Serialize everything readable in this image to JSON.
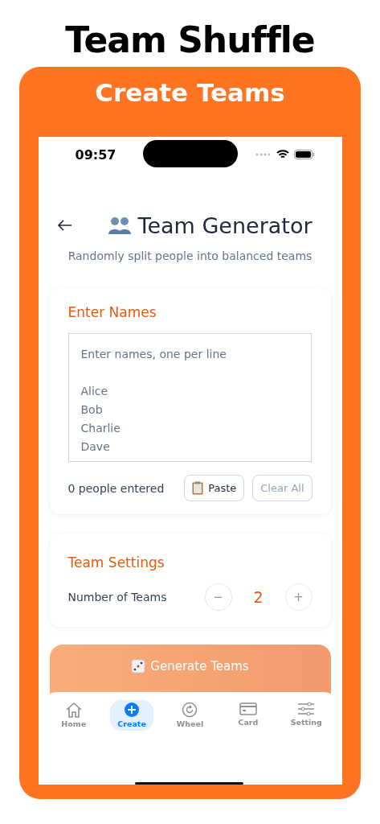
{
  "title": "Team Shuffle",
  "banner": "Create Teams",
  "status_bar": {
    "time": "09:57"
  },
  "header": {
    "title": "Team Generator",
    "subtitle": "Randomly split people into balanced teams"
  },
  "names_card": {
    "heading": "Enter Names",
    "placeholder": "Enter names, one per line\n\nAlice\nBob\nCharlie\nDave",
    "count": "0 people entered",
    "paste_button": "Paste",
    "clear_button": "Clear All"
  },
  "settings_card": {
    "heading": "Team Settings",
    "label": "Number of Teams",
    "decrement": "−",
    "value": "2",
    "increment": "+"
  },
  "generate_button": "Generate Teams",
  "tab_bar": [
    {
      "label": "Home",
      "kind": "home",
      "selected": false
    },
    {
      "label": "Create",
      "kind": "create",
      "selected": true
    },
    {
      "label": "Wheel",
      "kind": "wheel",
      "selected": false
    },
    {
      "label": "Card",
      "kind": "card",
      "selected": false
    },
    {
      "label": "Setting",
      "kind": "setting",
      "selected": false
    }
  ]
}
